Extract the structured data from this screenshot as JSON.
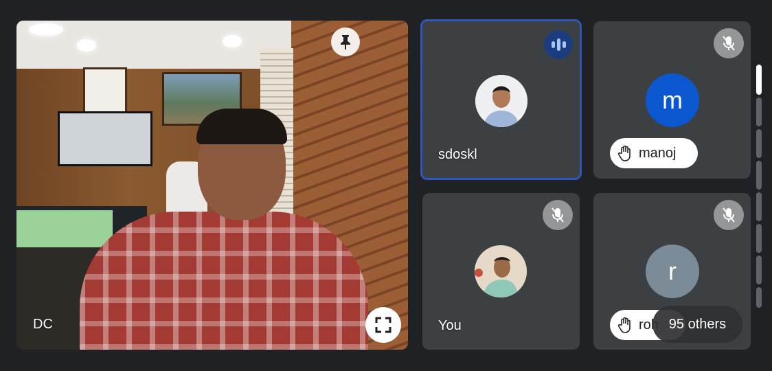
{
  "main": {
    "name": "DC"
  },
  "participants": [
    {
      "name": "sdoskl",
      "state": "speaking"
    },
    {
      "name": "manoj",
      "avatar_letter": "m",
      "avatar_color": "#0b57d0",
      "hand_raised": true,
      "muted": true
    },
    {
      "name": "You",
      "muted": true
    },
    {
      "name": "roh",
      "avatar_letter": "r",
      "avatar_color": "#7b8b97",
      "hand_raised": true,
      "muted": true
    }
  ],
  "others": {
    "label": "95 others"
  },
  "colors": {
    "active_border": "#2d58b8",
    "tile_bg": "#3c4043",
    "page_bg": "#202124"
  },
  "icons": [
    "pin-icon",
    "fullscreen-icon",
    "audio-level-icon",
    "mic-off-icon",
    "raised-hand-icon"
  ]
}
